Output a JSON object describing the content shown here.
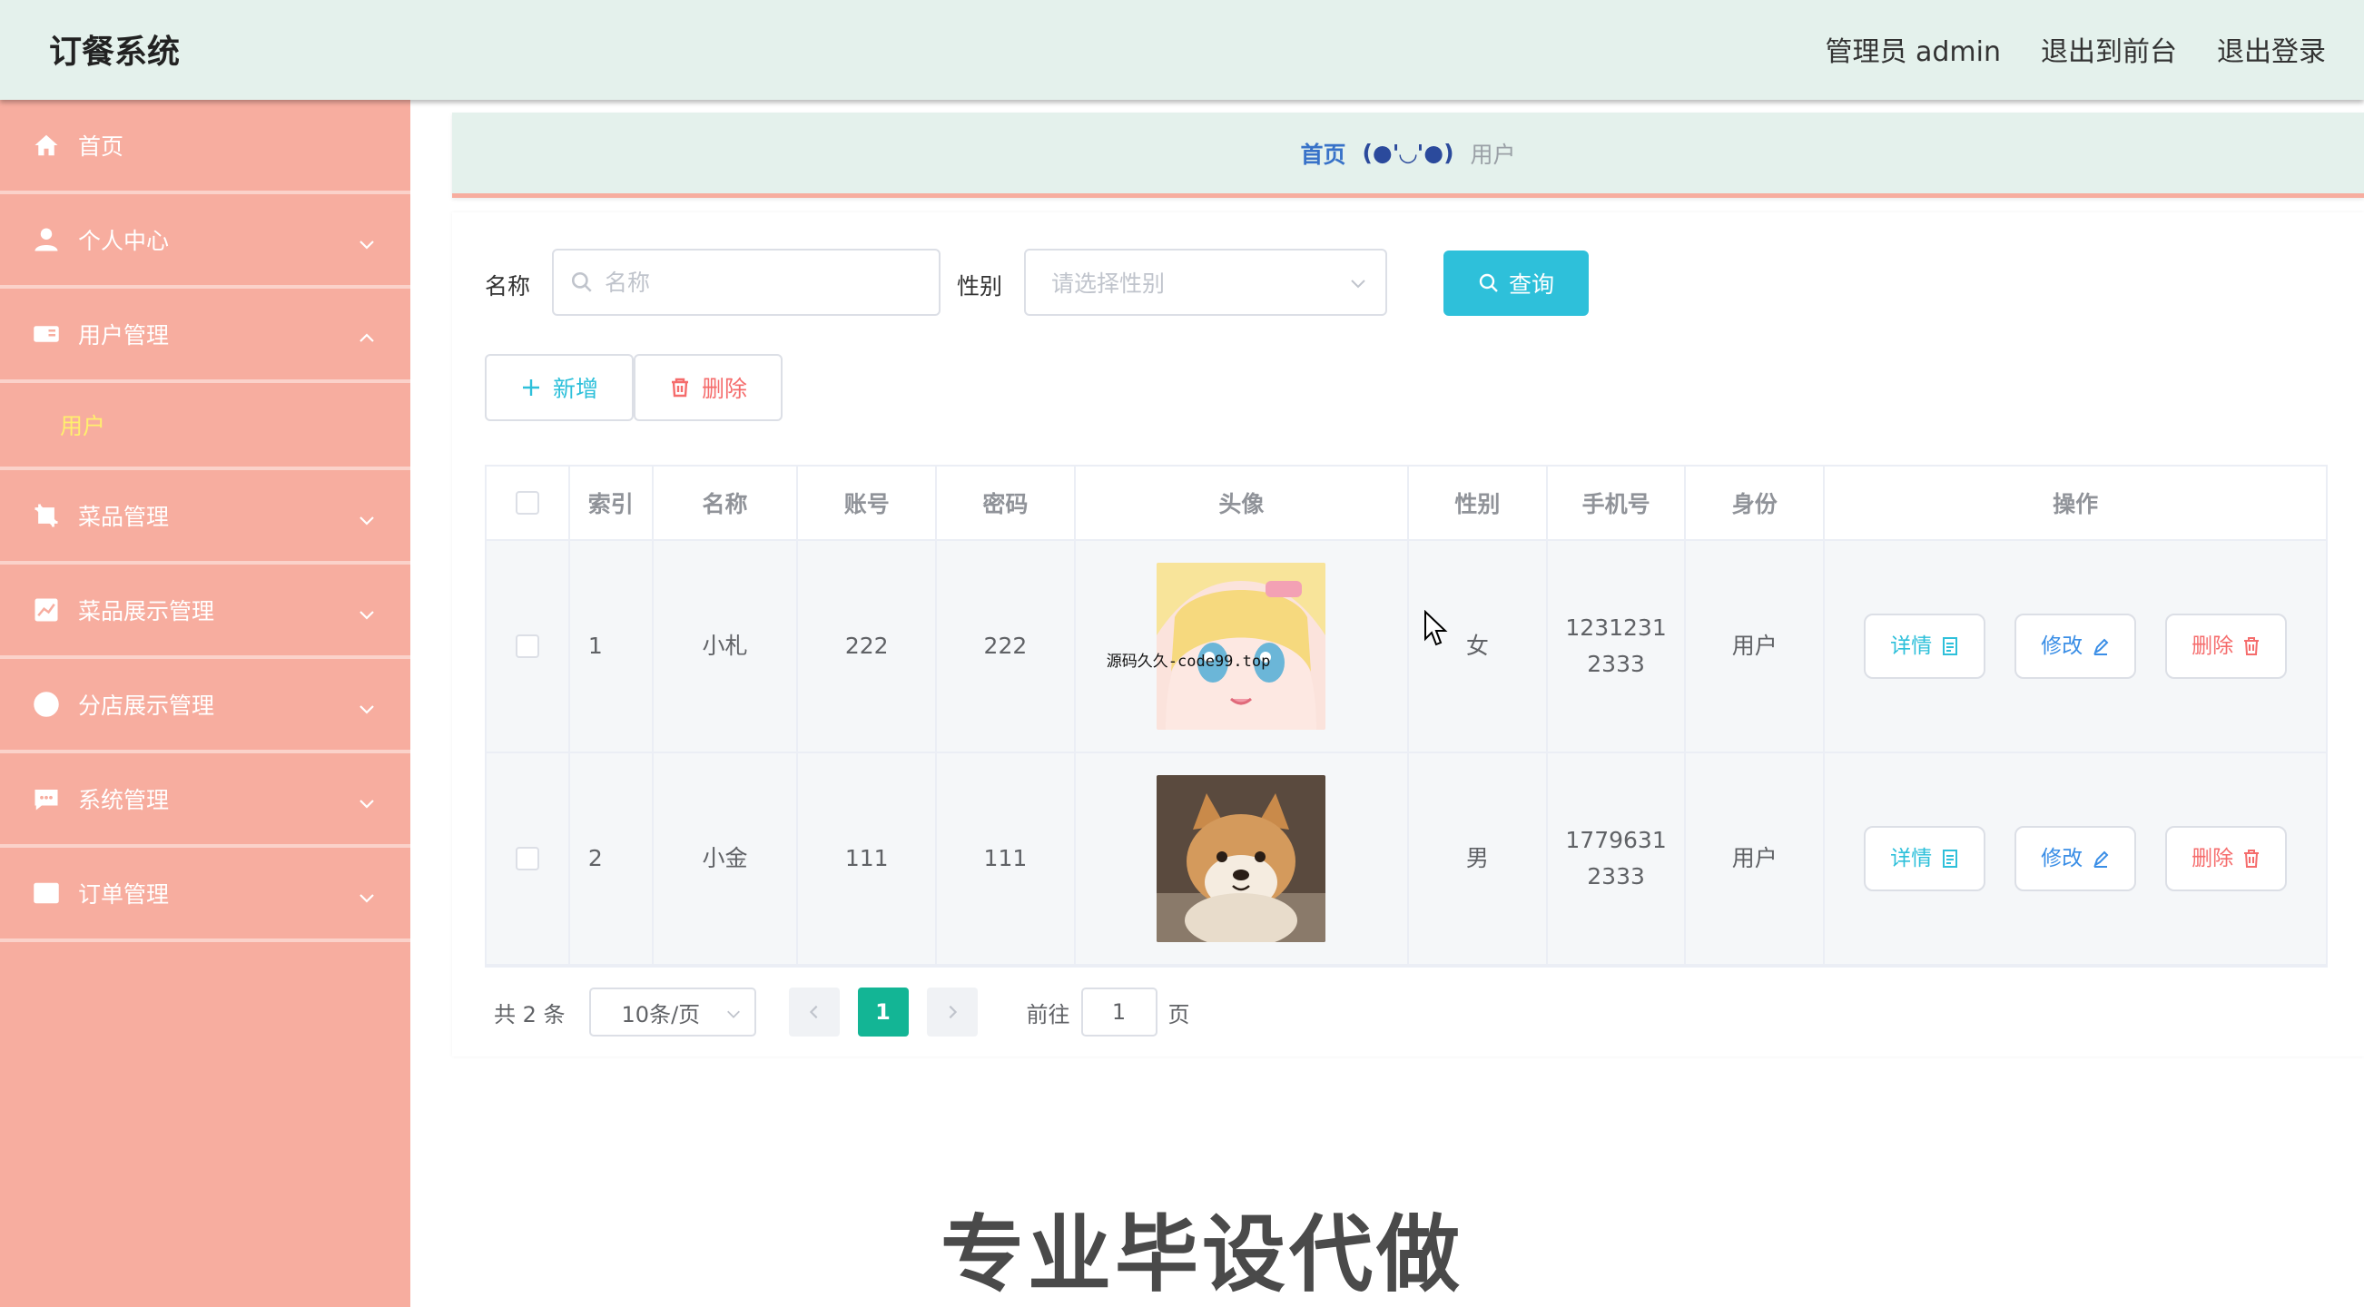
{
  "header": {
    "app_title": "订餐系统",
    "admin_label": "管理员 admin",
    "to_front": "退出到前台",
    "logout": "退出登录"
  },
  "sidebar": {
    "items": [
      {
        "label": "首页",
        "icon": "home-icon"
      },
      {
        "label": "个人中心",
        "icon": "user-icon"
      },
      {
        "label": "用户管理",
        "icon": "id-card-icon",
        "expanded": true,
        "children": [
          {
            "label": "用户",
            "active": true
          }
        ]
      },
      {
        "label": "菜品管理",
        "icon": "crop-icon"
      },
      {
        "label": "菜品展示管理",
        "icon": "chart-icon"
      },
      {
        "label": "分店展示管理",
        "icon": "compass-icon"
      },
      {
        "label": "系统管理",
        "icon": "message-icon"
      },
      {
        "label": "订单管理",
        "icon": "mail-icon"
      }
    ]
  },
  "breadcrumb": {
    "home": "首页",
    "separator": "(●'◡'●)",
    "current": "用户"
  },
  "search": {
    "name_label": "名称",
    "name_placeholder": "名称",
    "name_value": "",
    "gender_label": "性别",
    "gender_placeholder": "请选择性别",
    "query_button": "查询"
  },
  "actions": {
    "add": "新增",
    "delete": "删除"
  },
  "table": {
    "columns": [
      "索引",
      "名称",
      "账号",
      "密码",
      "头像",
      "性别",
      "手机号",
      "身份",
      "操作"
    ],
    "rows": [
      {
        "index": "1",
        "name": "小札",
        "account": "222",
        "password": "222",
        "avatar": "anime-girl-avatar",
        "avatar_watermark": "源码久久-code99.top",
        "gender": "女",
        "phone_line1": "1231231",
        "phone_line2": "2333",
        "role": "用户"
      },
      {
        "index": "2",
        "name": "小金",
        "account": "111",
        "password": "111",
        "avatar": "shiba-dog-avatar",
        "gender": "男",
        "phone_line1": "1779631",
        "phone_line2": "2333",
        "role": "用户"
      }
    ],
    "row_actions": {
      "detail": "详情",
      "edit": "修改",
      "delete": "删除"
    }
  },
  "pagination": {
    "total": "共 2 条",
    "page_size": "10条/页",
    "current_page": "1",
    "goto_label": "前往",
    "goto_value": "1",
    "page_suffix": "页"
  },
  "overlay": {
    "text": "专业毕设代做"
  },
  "colors": {
    "sidebar": "#f7ad9f",
    "header": "#e4f1ec",
    "primary": "#2ec0da",
    "active_page": "#13b595",
    "danger": "#f56c6c"
  }
}
